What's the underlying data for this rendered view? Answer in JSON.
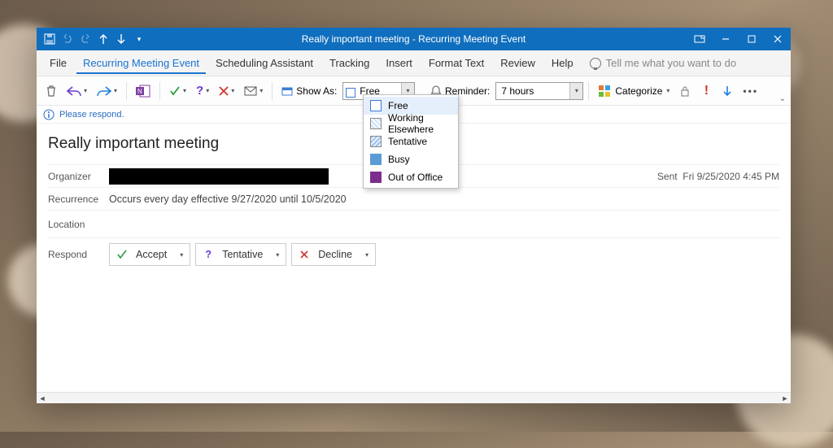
{
  "window": {
    "title": "Really important meeting  -  Recurring Meeting Event"
  },
  "tabs": {
    "file": "File",
    "event": "Recurring Meeting Event",
    "scheduling": "Scheduling Assistant",
    "tracking": "Tracking",
    "insert": "Insert",
    "format": "Format Text",
    "review": "Review",
    "help": "Help",
    "tellme": "Tell me what you want to do"
  },
  "toolbar": {
    "showas_label": "Show As:",
    "showas_value": "Free",
    "reminder_label": "Reminder:",
    "reminder_value": "7 hours",
    "categorize": "Categorize"
  },
  "showas_options": {
    "free": "Free",
    "working_elsewhere": "Working Elsewhere",
    "tentative": "Tentative",
    "busy": "Busy",
    "out_of_office": "Out of Office"
  },
  "infobar": {
    "text": "Please respond."
  },
  "meeting": {
    "subject": "Really important meeting",
    "labels": {
      "organizer": "Organizer",
      "recurrence": "Recurrence",
      "location": "Location",
      "respond": "Respond"
    },
    "recurrence_text": "Occurs every day effective 9/27/2020 until 10/5/2020",
    "sent_label": "Sent",
    "sent_value": "Fri 9/25/2020 4:45 PM"
  },
  "respond": {
    "accept": "Accept",
    "tentative": "Tentative",
    "decline": "Decline"
  }
}
